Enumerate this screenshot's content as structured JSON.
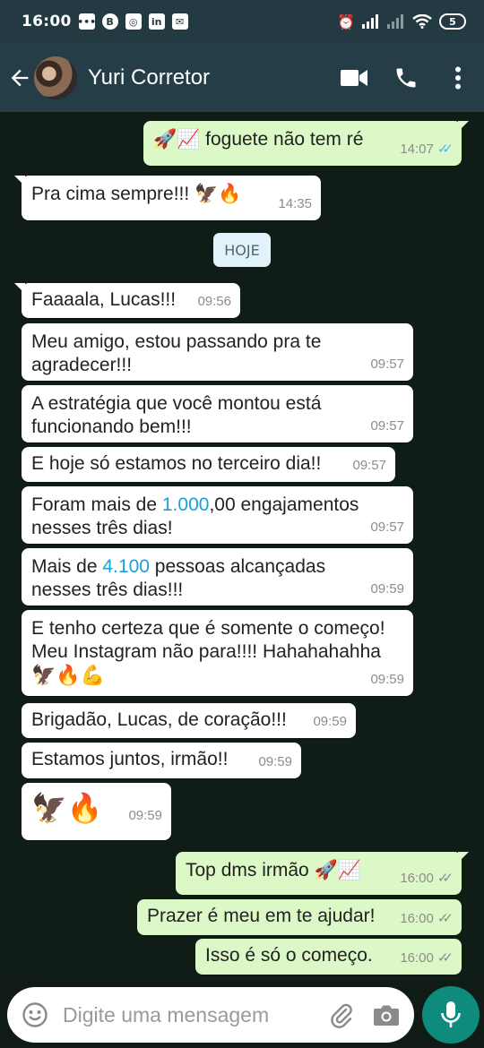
{
  "status_bar": {
    "time": "16:00",
    "battery": "5"
  },
  "header": {
    "contact_name": "Yuri Corretor"
  },
  "chat": {
    "date_chip": "HOJE",
    "messages": [
      {
        "dir": "out",
        "text": "🚀📈 foguete não tem ré",
        "time": "14:07",
        "status": "read"
      },
      {
        "dir": "in",
        "text": "Pra cima sempre!!! 🦅🔥",
        "time": "14:35"
      },
      {
        "dir": "in",
        "text": "Faaaala, Lucas!!!",
        "time": "09:56"
      },
      {
        "dir": "in",
        "text": "Meu amigo, estou passando pra te agradecer!!!",
        "time": "09:57"
      },
      {
        "dir": "in",
        "text": "A estratégia que você montou está funcionando bem!!!",
        "time": "09:57"
      },
      {
        "dir": "in",
        "text": "E hoje só estamos no terceiro dia!!",
        "time": "09:57"
      },
      {
        "dir": "in",
        "text_before": "Foram mais de ",
        "highlight": "1.000",
        "text_after": ",00 engajamentos nesses três dias!",
        "time": "09:57"
      },
      {
        "dir": "in",
        "text_before": "Mais de ",
        "highlight": "4.100",
        "text_after": " pessoas alcançadas nesses três dias!!!",
        "time": "09:59"
      },
      {
        "dir": "in",
        "text": "E tenho certeza que é somente o começo! Meu Instagram não para!!!! Hahahahahha",
        "emoji_line": "🦅🔥💪",
        "time": "09:59"
      },
      {
        "dir": "in",
        "text": "Brigadão, Lucas, de coração!!!",
        "time": "09:59"
      },
      {
        "dir": "in",
        "text": "Estamos juntos, irmão!!",
        "time": "09:59"
      },
      {
        "dir": "in",
        "text": "🦅🔥",
        "time": "09:59"
      },
      {
        "dir": "out",
        "text": "Top dms irmão 🚀📈",
        "time": "16:00",
        "status": "sent"
      },
      {
        "dir": "out",
        "text": "Prazer é meu em te ajudar!",
        "time": "16:00",
        "status": "sent"
      },
      {
        "dir": "out",
        "text": "Isso é só o começo.",
        "time": "16:00",
        "status": "sent"
      }
    ]
  },
  "input": {
    "placeholder": "Digite uma mensagem"
  },
  "colors": {
    "header": "#253d46",
    "outgoing": "#dcf8c6",
    "incoming": "#ffffff",
    "mic": "#0e8b7d",
    "read_tick": "#4fb6ec"
  },
  "icons": [
    "back-arrow-icon",
    "video-call-icon",
    "phone-icon",
    "more-vert-icon",
    "emoji-icon",
    "attach-icon",
    "camera-icon",
    "mic-icon"
  ]
}
